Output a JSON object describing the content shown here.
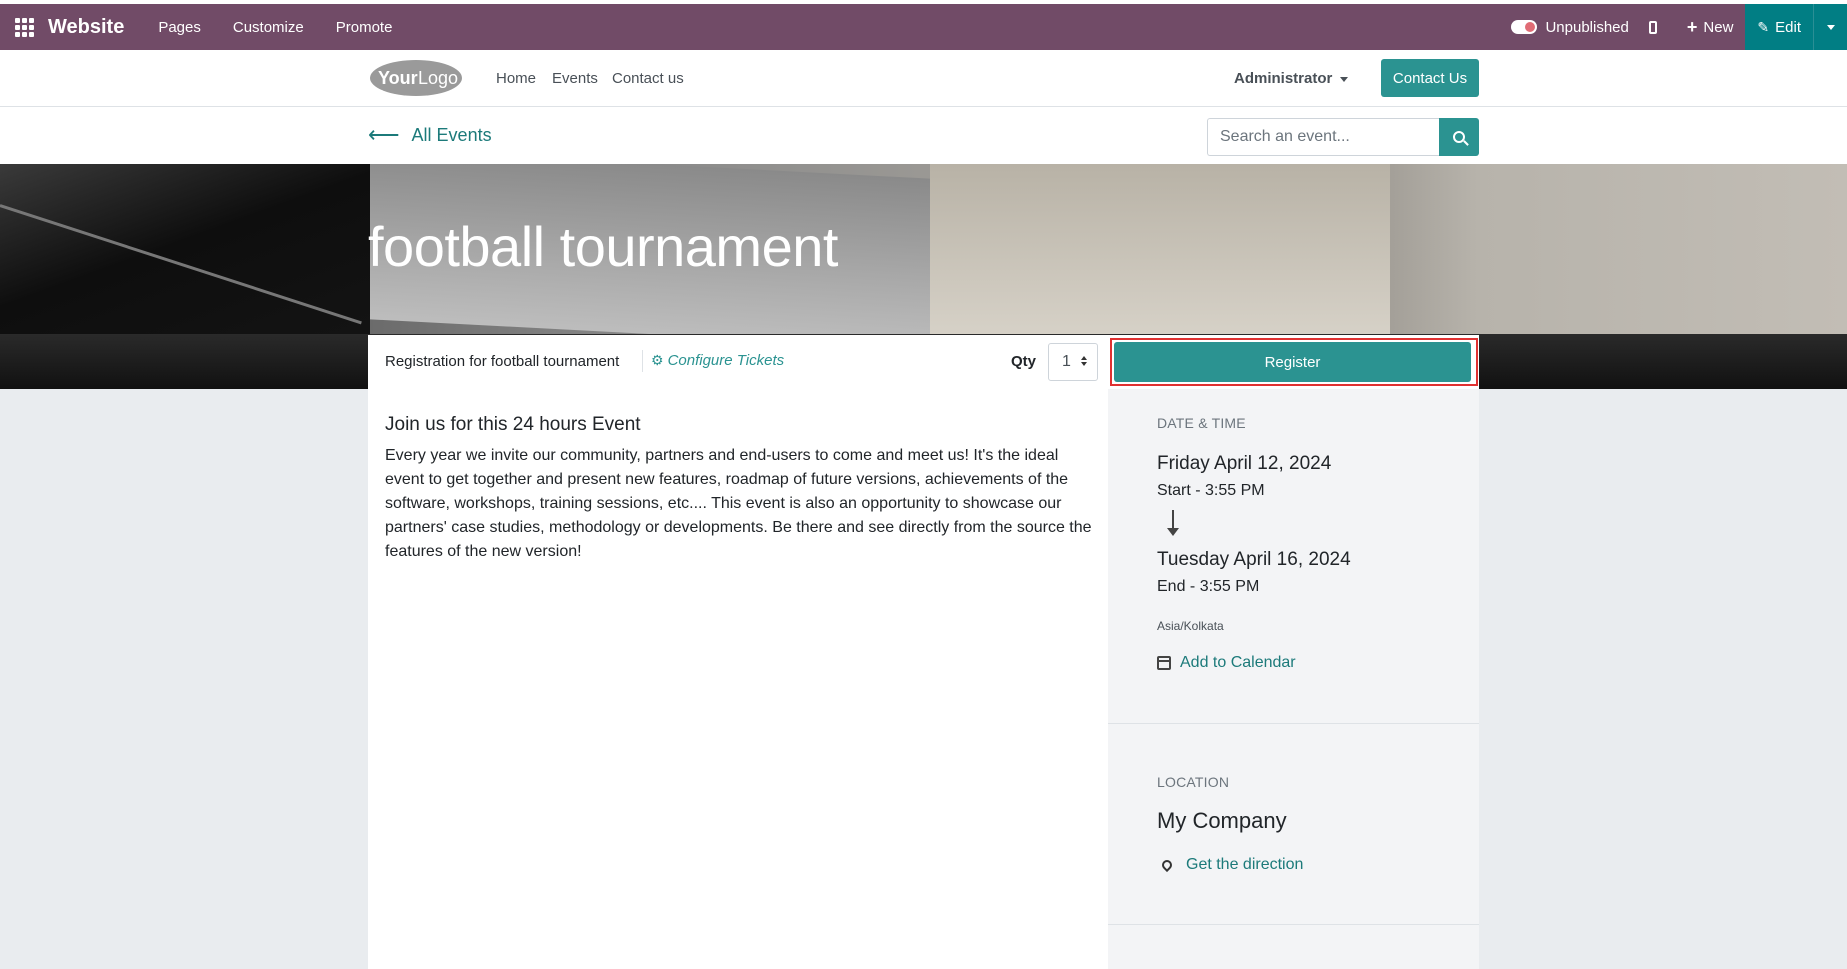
{
  "topbar": {
    "app_title": "Website",
    "menu": [
      "Pages",
      "Customize",
      "Promote"
    ],
    "publish_status": "Unpublished",
    "new_label": "New",
    "edit_label": "Edit",
    "edit_icon": "pencil-icon",
    "accent": "#714b67"
  },
  "header": {
    "logo_text": "YourLogo",
    "nav": [
      "Home",
      "Events",
      "Contact us"
    ],
    "user": "Administrator",
    "contact_button": "Contact Us"
  },
  "subnav": {
    "back_label": "All Events",
    "search_placeholder": "Search an event..."
  },
  "event": {
    "title": "football tournament",
    "registration_label": "Registration for football tournament",
    "configure_label": "Configure Tickets",
    "qty_label": "Qty",
    "qty_value": "1",
    "register_label": "Register",
    "heading": "Join us for this 24 hours Event",
    "description": "Every year we invite our community, partners and end-users to come and meet us! It's the ideal event to get together and present new features, roadmap of future versions, achievements of the software, workshops, training sessions, etc.... This event is also an opportunity to showcase our partners' case studies, methodology or developments. Be there and see directly from the source the features of the new version!"
  },
  "sidebar": {
    "datetime_label": "DATE & TIME",
    "start_date": "Friday April 12, 2024",
    "start_time": "Start - 3:55 PM",
    "end_date": "Tuesday April 16, 2024",
    "end_time": "End - 3:55 PM",
    "timezone": "Asia/Kolkata",
    "calendar_link": "Add to Calendar",
    "location_label": "LOCATION",
    "company": "My Company",
    "direction_link": "Get the direction"
  },
  "colors": {
    "primary": "#2b9391",
    "edit_bg": "#017e84",
    "highlight": "#e03131"
  }
}
